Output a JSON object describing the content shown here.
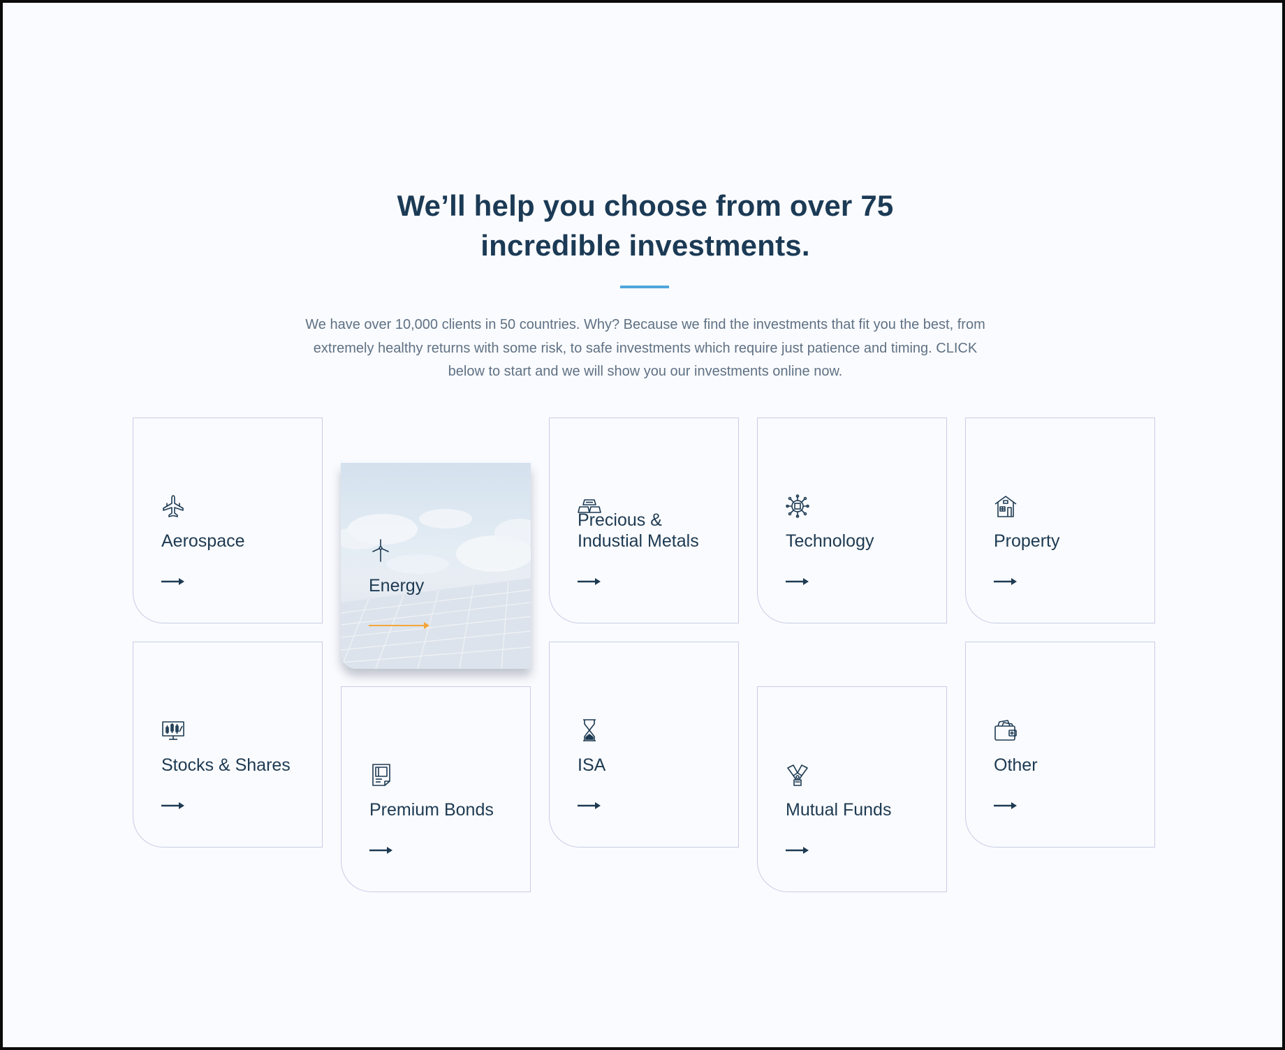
{
  "header": {
    "title_line1": "We’ll help you choose from over 75",
    "title_line2": "incredible investments.",
    "intro": "We have over 10,000 clients in 50 countries. Why? Because we find the investments that fit you the best, from extremely healthy returns with some risk, to safe investments which require just patience and timing. CLICK below to start and we will show you our investments online now.",
    "accent_color": "#4ea6dc"
  },
  "categories": [
    {
      "label": "Aerospace",
      "icon": "plane-icon"
    },
    {
      "label": "Energy",
      "icon": "wind-turbine-icon",
      "highlighted": true
    },
    {
      "label": "Precious & Industial Metals",
      "icon": "gold-bars-icon"
    },
    {
      "label": "Technology",
      "icon": "chip-icon"
    },
    {
      "label": "Property",
      "icon": "house-icon"
    },
    {
      "label": "Stocks & Shares",
      "icon": "stock-monitor-icon"
    },
    {
      "label": "Premium Bonds",
      "icon": "bond-document-icon"
    },
    {
      "label": "ISA",
      "icon": "hourglass-icon"
    },
    {
      "label": "Mutual Funds",
      "icon": "handshake-icon"
    },
    {
      "label": "Other",
      "icon": "wallet-icon"
    }
  ],
  "colors": {
    "text": "#1d3a52",
    "card_border": "#c7cde6",
    "arrow_highlight": "#f4a63a"
  }
}
